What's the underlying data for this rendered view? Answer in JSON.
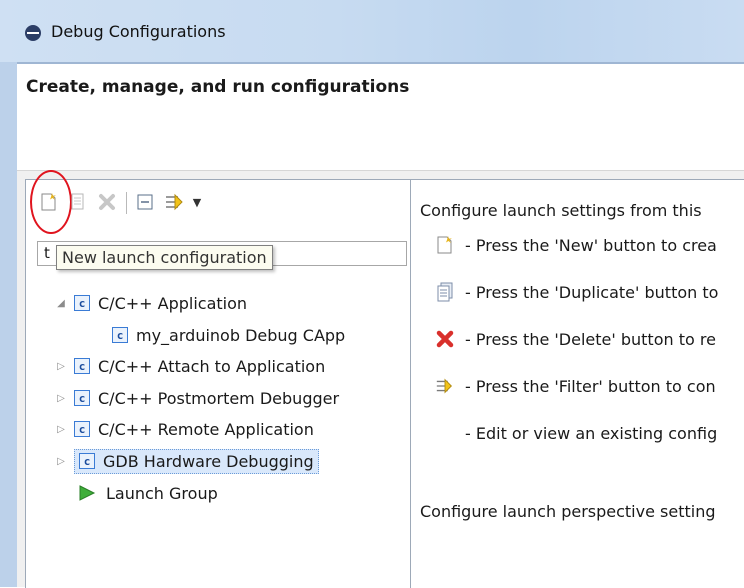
{
  "window": {
    "title": "Debug Configurations"
  },
  "header": {
    "title": "Create, manage, and run configurations"
  },
  "toolbar": {
    "buttons": [
      {
        "name": "new-launch-configuration"
      },
      {
        "name": "duplicate"
      },
      {
        "name": "delete"
      },
      {
        "name": "collapse-all"
      },
      {
        "name": "filter"
      }
    ],
    "tooltip": "New launch configuration"
  },
  "filter_field": {
    "value": "t"
  },
  "tree": {
    "items": [
      {
        "label": "C/C++ Application",
        "expanded": true
      },
      {
        "label": "my_arduinob Debug CApp",
        "child": true
      },
      {
        "label": "C/C++ Attach to Application"
      },
      {
        "label": "C/C++ Postmortem Debugger"
      },
      {
        "label": "C/C++ Remote Application"
      },
      {
        "label": "GDB Hardware Debugging",
        "selected": true
      },
      {
        "label": "Launch Group"
      }
    ]
  },
  "right": {
    "intro": "Configure launch settings from this",
    "lines": [
      {
        "icon": "new-icon",
        "text": "- Press the 'New' button to crea"
      },
      {
        "icon": "duplicate-icon",
        "text": "- Press the 'Duplicate' button to"
      },
      {
        "icon": "delete-icon",
        "text": "- Press the 'Delete' button to re"
      },
      {
        "icon": "filter-icon",
        "text": "- Press the 'Filter' button to con"
      },
      {
        "icon": "",
        "text": "- Edit or view an existing config"
      }
    ],
    "footer": "Configure launch perspective setting"
  },
  "colors": {
    "accent": "#3a7bd5",
    "highlight": "#e0141e",
    "selection": "#d9e8fb"
  }
}
